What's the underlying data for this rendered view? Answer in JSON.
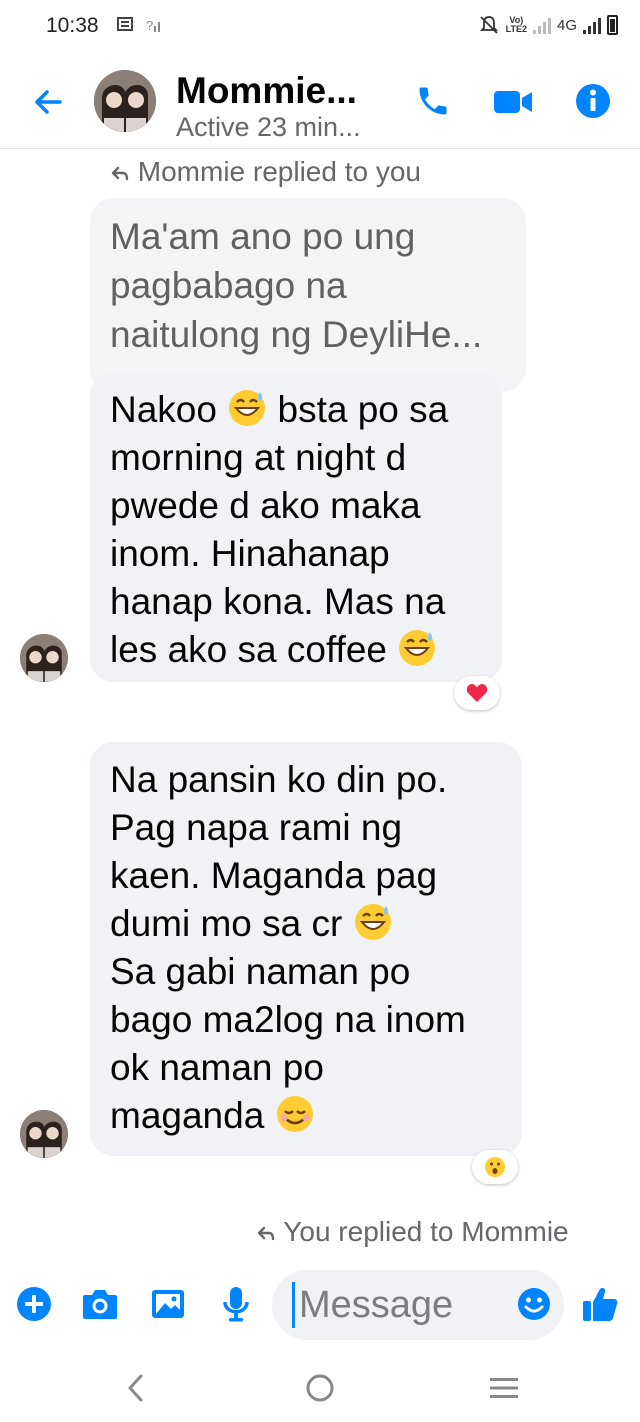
{
  "status_bar": {
    "time": "10:38",
    "network_label": "4G"
  },
  "header": {
    "contact_name": "Mommie...",
    "status": "Active 23 min..."
  },
  "messages": {
    "reply_note_top": "Mommie replied to you",
    "quoted_text": "Ma'am ano po ung pagbabago na naitulong ng DeyliHe...",
    "msg1": {
      "line1": "Nakoo",
      "line1b": " bsta po sa",
      "rest": "morning at night d\npwede d ako maka\ninom. Hinahanap\nhanap kona. Mas na",
      "last": "les ako sa coffee ",
      "reaction": "heart"
    },
    "msg2": {
      "text_a": "Na pansin ko din po.\nPag napa rami ng\nkaen. Maganda pag",
      "line4": "dumi mo sa cr ",
      "text_b": "Sa gabi naman po\nbago ma2log na inom\nok naman po",
      "last": "maganda ",
      "reaction": "wow"
    },
    "reply_note_bottom": "You replied to Mommie"
  },
  "composer": {
    "placeholder": "Message"
  },
  "colors": {
    "accent": "#0084ff",
    "bubble": "#f0f2f5",
    "secondary_text": "#65676b"
  },
  "icons": [
    "back-arrow-icon",
    "phone-icon",
    "video-camera-icon",
    "info-icon",
    "plus-icon",
    "camera-icon",
    "image-icon",
    "microphone-icon",
    "emoji-icon",
    "thumbs-up-icon",
    "nav-back-icon",
    "nav-home-icon",
    "nav-recents-icon"
  ]
}
